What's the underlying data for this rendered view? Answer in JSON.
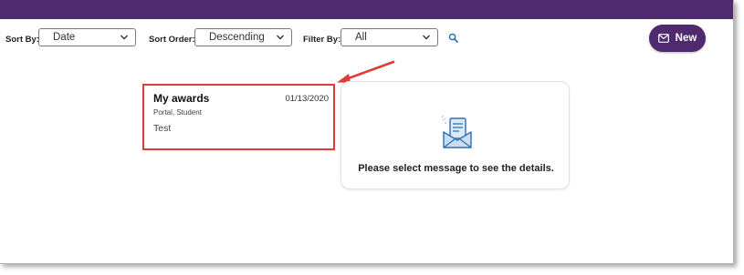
{
  "toolbar": {
    "sort_by_label": "Sort By:",
    "sort_by_value": "Date",
    "sort_order_label": "Sort Order:",
    "sort_order_value": "Descending",
    "filter_by_label": "Filter By:",
    "filter_by_value": "All",
    "search_icon": "search-icon",
    "new_button_label": "New",
    "new_button_icon": "envelope-icon"
  },
  "message_list": [
    {
      "title": "My awards",
      "date": "01/13/2020",
      "sender": "Portal, Student",
      "body": "Test"
    }
  ],
  "detail_panel": {
    "icon": "open-envelope-icon",
    "empty_text": "Please select message to see the details."
  },
  "colors": {
    "brand_purple": "#4f2a6e",
    "highlight_red": "#e03b3b",
    "icon_blue": "#2f6fb3"
  }
}
